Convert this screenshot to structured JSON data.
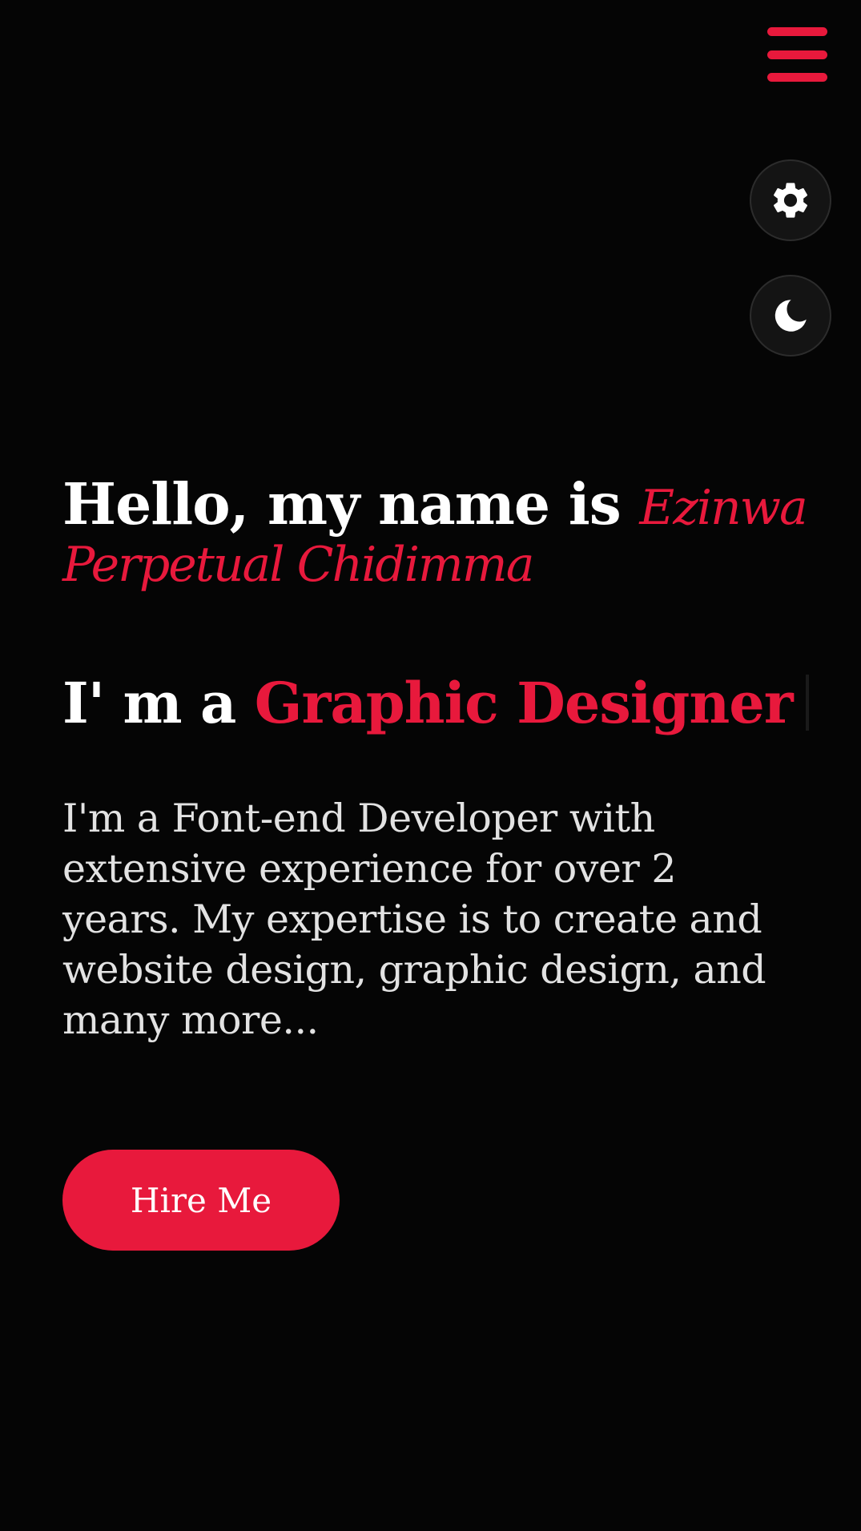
{
  "header": {
    "menu_icon": "hamburger-menu-icon"
  },
  "controls": {
    "settings_icon": "gear-icon",
    "theme_icon": "moon-icon"
  },
  "hero": {
    "greeting": "Hello, my name is",
    "name": "Ezinwa Perpetual Chidimma",
    "role_prefix": "I' m a",
    "role": "Graphic Designer",
    "bio": "I'm a Font-end Developer with extensive experience for over 2 years. My expertise is to create and website design, graphic design, and many more...",
    "cta_label": "Hire Me"
  },
  "colors": {
    "accent": "#e8193c",
    "background": "#050505",
    "text": "#ffffff",
    "muted_text": "#e2e2e2",
    "control_background": "#141414"
  }
}
